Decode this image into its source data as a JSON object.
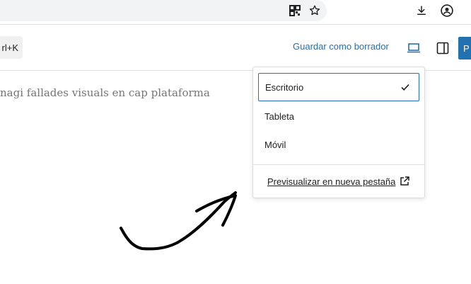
{
  "browser": {
    "icons": [
      "qr-code-icon",
      "bookmark-star-icon",
      "download-icon",
      "account-icon"
    ]
  },
  "header": {
    "shortcut_label": "rl+K",
    "save_draft_label": "Guardar como borrador",
    "publish_label": "P"
  },
  "document": {
    "visible_text": "nagi fallades visuals en cap plataforma"
  },
  "preview_menu": {
    "items": [
      {
        "label": "Escritorio",
        "selected": true
      },
      {
        "label": "Tableta",
        "selected": false
      },
      {
        "label": "Móvil",
        "selected": false
      }
    ],
    "external_link_label": "Previsualizar en nueva pestaña"
  },
  "colors": {
    "accent": "#2271b1",
    "text": "#1e1e1e",
    "muted_text": "#757575"
  }
}
